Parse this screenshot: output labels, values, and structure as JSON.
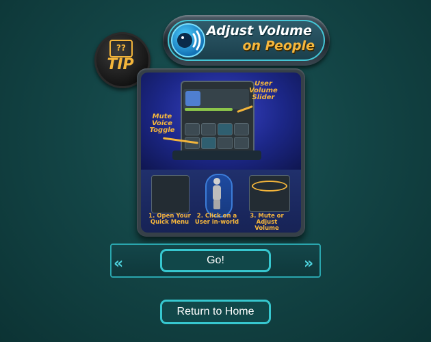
{
  "title": {
    "line1": "Adjust Volume",
    "line2": "on People",
    "icon": "speaker-wave-icon"
  },
  "tip": {
    "bubble_text": "?",
    "label": "TIP"
  },
  "illustration": {
    "callout_user_volume": "User Volume Slider",
    "callout_mute_voice": "Mute Voice Toggle"
  },
  "steps": [
    {
      "label": "1. Open Your Quick Menu"
    },
    {
      "label": "2. Click on a User in-world"
    },
    {
      "label": "3. Mute or Adjust Volume"
    }
  ],
  "actions": {
    "go_label": "Go!",
    "prev_glyph": "«",
    "next_glyph": "»",
    "home_label": "Return to Home"
  },
  "colors": {
    "accent_gold": "#f6b73c",
    "accent_teal": "#37c7cf",
    "background": "#134546"
  }
}
